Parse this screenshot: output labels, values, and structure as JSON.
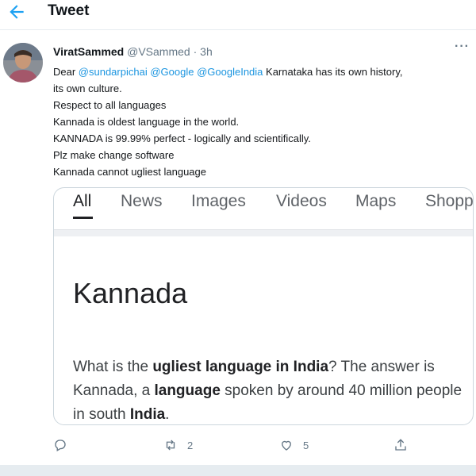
{
  "header": {
    "title": "Tweet",
    "back_icon": "arrow-left-icon"
  },
  "tweet": {
    "name": "ViratSammed",
    "handle": "@VSammed",
    "separator": "·",
    "time": "3h",
    "more_icon": "more-horizontal-icon",
    "lines": [
      {
        "prefix": "Dear ",
        "mentions": [
          "@sundarpichai",
          "@Google",
          "@GoogleIndia"
        ],
        "text": " Karnataka has its own history,"
      },
      "its own culture.",
      "Respect to all languages",
      "Kannada  is oldest language in the world.",
      "KANNADA is 99.99% perfect - logically and scientifically.",
      "Plz make change software",
      "Kannada cannot ugliest language"
    ]
  },
  "card": {
    "tabs": [
      "All",
      "News",
      "Images",
      "Videos",
      "Maps",
      "Shopp"
    ],
    "active_tab": "All",
    "result_title": "Kannada",
    "snippet": [
      {
        "text": "What is the ",
        "bold": false
      },
      {
        "text": "ugliest language in India",
        "bold": true
      },
      {
        "text": "? The answer is Kannada, a ",
        "bold": false
      },
      {
        "text": "language",
        "bold": true
      },
      {
        "text": " spoken by around 40 million people in south ",
        "bold": false
      },
      {
        "text": "India",
        "bold": true
      },
      {
        "text": ".",
        "bold": false
      }
    ]
  },
  "actions": {
    "reply_icon": "reply-icon",
    "retweet_icon": "retweet-icon",
    "retweets": "2",
    "like_icon": "heart-icon",
    "likes": "5",
    "share_icon": "share-icon"
  },
  "colors": {
    "accent": "#1da1f2",
    "mention": "#1b95e0",
    "muted": "#657786"
  }
}
